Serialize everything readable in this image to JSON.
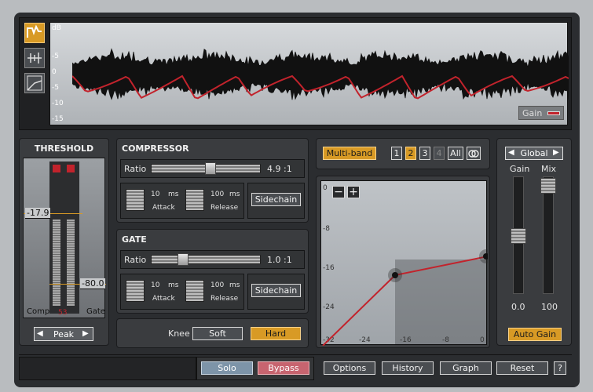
{
  "waveform": {
    "db_labels": [
      "dB",
      "-5",
      "0",
      "-5",
      "-10",
      "-15"
    ],
    "gain_label": "Gain"
  },
  "threshold": {
    "title": "THRESHOLD",
    "upper_value": "-17.9",
    "lower_value": "-80.0",
    "left_label": "Comp",
    "right_label": "Gate",
    "meter_value": "53",
    "mode": "Peak"
  },
  "compressor": {
    "title": "COMPRESSOR",
    "ratio_label": "Ratio",
    "ratio_value": "4.9 :1",
    "attack_value": "10",
    "attack_unit": "ms",
    "attack_label": "Attack",
    "release_value": "100",
    "release_unit": "ms",
    "release_label": "Release",
    "sidechain": "Sidechain"
  },
  "gate": {
    "title": "GATE",
    "ratio_label": "Ratio",
    "ratio_value": "1.0 :1",
    "attack_value": "10",
    "attack_unit": "ms",
    "attack_label": "Attack",
    "release_value": "100",
    "release_unit": "ms",
    "release_label": "Release",
    "sidechain": "Sidechain"
  },
  "knee": {
    "label": "Knee",
    "soft": "Soft",
    "hard": "Hard"
  },
  "bands": {
    "multiband": "Multi-band",
    "b1": "1",
    "b2": "2",
    "b3": "3",
    "b4": "4",
    "all": "All"
  },
  "graph": {
    "y_labels": [
      "0",
      "-8",
      "-16",
      "-24",
      "-32"
    ],
    "x_labels": [
      "-32",
      "-24",
      "-16",
      "-8",
      "0"
    ],
    "minus": "−",
    "plus": "+"
  },
  "output": {
    "global": "Global",
    "gain_label": "Gain",
    "mix_label": "Mix",
    "gain_value": "0.0",
    "mix_value": "100",
    "auto_gain": "Auto Gain"
  },
  "bottom": {
    "solo": "Solo",
    "bypass": "Bypass",
    "options": "Options",
    "history": "History",
    "graph": "Graph",
    "reset": "Reset",
    "help": "?"
  }
}
